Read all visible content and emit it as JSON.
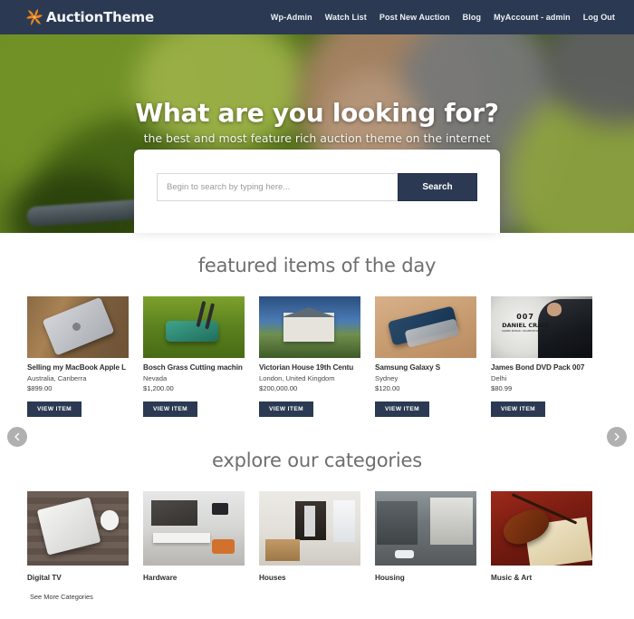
{
  "header": {
    "logo_icon": "pinwheel-icon",
    "brand": "AuctionTheme",
    "nav": [
      {
        "label": "Wp-Admin"
      },
      {
        "label": "Watch List"
      },
      {
        "label": "Post New Auction"
      },
      {
        "label": "Blog"
      },
      {
        "label": "MyAccount - admin"
      },
      {
        "label": "Log Out"
      }
    ]
  },
  "hero": {
    "title": "What are you looking for?",
    "subtitle": "the best and most feature rich auction theme on the internet"
  },
  "search": {
    "placeholder": "Begin to search by typing here...",
    "value": "",
    "button_label": "Search"
  },
  "featured": {
    "title": "featured items of the day",
    "prev_icon": "chevron-left-icon",
    "next_icon": "chevron-right-icon",
    "view_item_label": "VIEW ITEM",
    "items": [
      {
        "title": "Selling my MacBook Apple L",
        "location": "Australia, Canberra",
        "price": "$899.00",
        "image": "macbook-on-wood-photo"
      },
      {
        "title": "Bosch Grass Cutting machin",
        "location": "Nevada",
        "price": "$1,200.00",
        "image": "lawn-mower-on-grass-photo"
      },
      {
        "title": "Victorian House 19th Centu",
        "location": "London, United Kingdom",
        "price": "$200,000.00",
        "image": "victorian-house-photo"
      },
      {
        "title": "Samsung Galaxy S",
        "location": "Sydney",
        "price": "$120.00",
        "image": "samsung-galaxy-phone-photo"
      },
      {
        "title": "James Bond DVD Pack 007",
        "location": "Delhi",
        "price": "$80.99",
        "image": "james-bond-dvd-cover",
        "cover_line1": "007",
        "cover_line2": "DANIEL CRAIG",
        "cover_line3": "CASINO ROYALE / QUANTUM OF SOLACE"
      }
    ]
  },
  "categories": {
    "title": "explore our categories",
    "see_more_label": "See More Categories",
    "items": [
      {
        "label": "Digital TV",
        "image": "laptop-on-wood-photo"
      },
      {
        "label": "Hardware",
        "image": "modern-living-room-photo"
      },
      {
        "label": "Houses",
        "image": "white-kitchen-interior-photo"
      },
      {
        "label": "Housing",
        "image": "street-with-houses-photo"
      },
      {
        "label": "Music & Art",
        "image": "violin-sheet-music-photo"
      }
    ]
  },
  "colors": {
    "navy": "#2b3a52",
    "logo_orange": "#e8861f",
    "section_title_gray": "#6e6e6e",
    "page_background": "#ffffff"
  }
}
